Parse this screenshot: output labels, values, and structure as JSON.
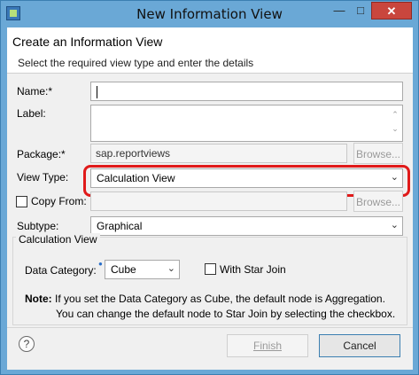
{
  "window": {
    "title": "New Information View"
  },
  "header": {
    "title": "Create an Information View",
    "subtitle": "Select the required view type and enter the details"
  },
  "form": {
    "name_label": "Name:*",
    "name_value": "",
    "label_label": "Label:",
    "label_value": "",
    "package_label": "Package:*",
    "package_value": "sap.reportviews",
    "browse_label": "Browse...",
    "view_type_label": "View Type:",
    "view_type_value": "Calculation View",
    "copy_from_label": "Copy From:",
    "copy_from_value": "",
    "copy_from_checked": false,
    "browse2_label": "Browse...",
    "subtype_label": "Subtype:",
    "subtype_value": "Graphical"
  },
  "calc_group": {
    "title": "Calculation View",
    "data_category_label": "Data Category:",
    "data_category_value": "Cube",
    "star_join_label": "With Star Join",
    "star_join_checked": false,
    "note_prefix": "Note:",
    "note_line1": "If you set the Data Category as Cube, the default node is Aggregation.",
    "note_line2": "You can change the default node to Star Join by selecting the checkbox."
  },
  "footer": {
    "help_label": "?",
    "finish_label": "Finish",
    "cancel_label": "Cancel"
  },
  "colors": {
    "title_bar": "#6aa8d6",
    "close_button": "#c9463d",
    "highlight": "#e01a1a"
  }
}
